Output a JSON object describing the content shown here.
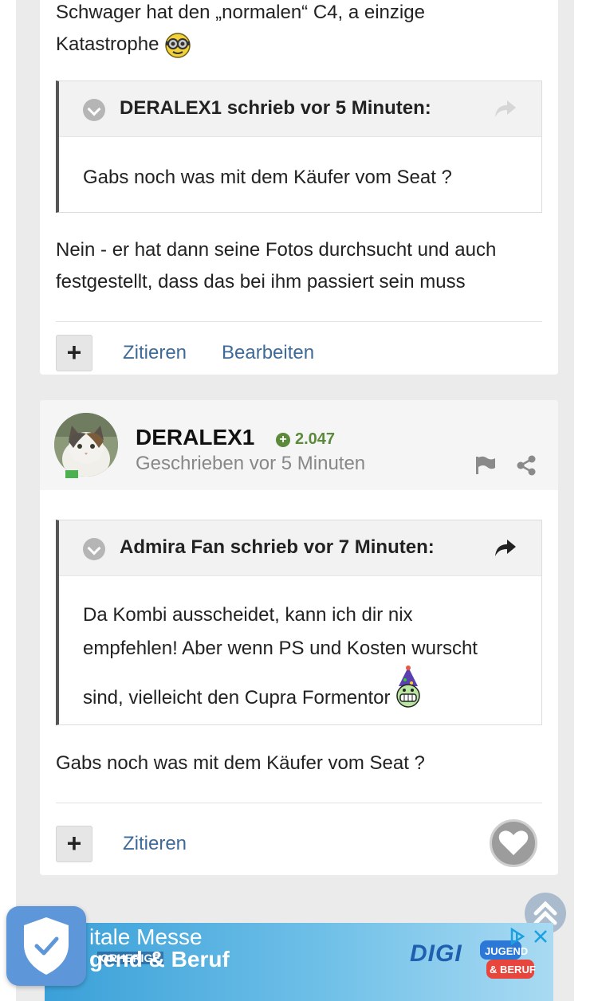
{
  "post1": {
    "text_line1": "Schwager hat den „normalen“ C4, a einzige",
    "text_line2": "Katastrophe",
    "quote": {
      "author": "DERALEX1 schrieb vor 5 Minuten:",
      "text": "Gabs noch was mit dem Käufer vom Seat ?"
    },
    "reply_line1": "Nein - er hat dann seine Fotos durchsucht und auch",
    "reply_line2": "festgestellt, dass das bei ihm passiert sein muss",
    "actions": {
      "plus": "+",
      "quote": "Zitieren",
      "edit": "Bearbeiten"
    }
  },
  "post2": {
    "author": "DERALEX1",
    "reputation": "2.047",
    "posted": "Geschrieben vor 5 Minuten",
    "quote": {
      "author": "Admira Fan schrieb vor 7 Minuten:",
      "line1": "Da Kombi ausscheidet, kann ich dir nix",
      "line2": "empfehlen! Aber wenn PS und Kosten wurscht",
      "line3": "sind, vielleicht den Cupra Formentor"
    },
    "text": "Gabs noch was mit dem Käufer vom Seat ?",
    "actions": {
      "plus": "+",
      "quote": "Zitieren"
    }
  },
  "ad": {
    "line1": "itale Messe",
    "line2": "gend & Beruf",
    "small": "ORHERIGE",
    "logo_digi": "DIGI",
    "logo_jugend": "JUGEND",
    "logo_beruf": "& BERUF"
  },
  "colors": {
    "link": "#3d6a99",
    "reputation": "#5a8a3a",
    "quote_border": "#555555",
    "shield": "#5e96da"
  },
  "icons": [
    "chevron-down-icon",
    "share-arrow-icon",
    "flag-icon",
    "share-icon",
    "heart-icon",
    "scroll-top-icon",
    "shield-check-icon",
    "adchoices-icon",
    "close-icon"
  ]
}
